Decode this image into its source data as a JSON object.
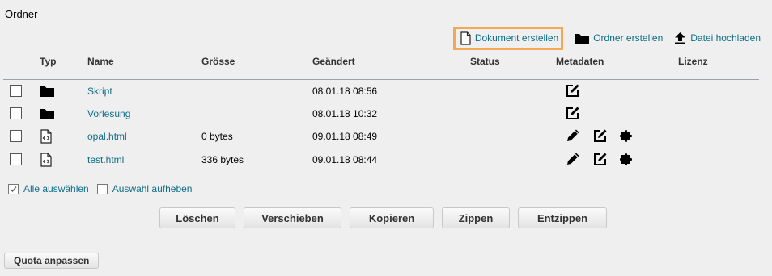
{
  "page": {
    "title": "Ordner"
  },
  "actions": {
    "create_document": "Dokument erstellen",
    "create_folder": "Ordner erstellen",
    "upload_file": "Datei hochladen"
  },
  "table": {
    "headers": {
      "type": "Typ",
      "name": "Name",
      "size": "Grösse",
      "modified": "Geändert",
      "status": "Status",
      "metadata": "Metadaten",
      "license": "Lizenz"
    },
    "rows": [
      {
        "type": "folder",
        "name": "Skript",
        "size": "",
        "modified": "08.01.18 08:56",
        "icons": [
          "edit-icon"
        ]
      },
      {
        "type": "folder",
        "name": "Vorlesung",
        "size": "",
        "modified": "08.01.18 10:32",
        "icons": [
          "edit-icon"
        ]
      },
      {
        "type": "html-file",
        "name": "opal.html",
        "size": "0 bytes",
        "modified": "09.01.18 08:49",
        "icons": [
          "pencil-icon",
          "edit-icon",
          "puzzle-icon"
        ]
      },
      {
        "type": "html-file",
        "name": "test.html",
        "size": "336 bytes",
        "modified": "09.01.18 08:44",
        "icons": [
          "pencil-icon",
          "edit-icon",
          "puzzle-icon"
        ]
      }
    ]
  },
  "selection": {
    "select_all": "Alle auswählen",
    "deselect": "Auswahl aufheben"
  },
  "buttons": {
    "delete": "Löschen",
    "move": "Verschieben",
    "copy": "Kopieren",
    "zip": "Zippen",
    "unzip": "Entzippen",
    "quota": "Quota anpassen"
  },
  "colors": {
    "link": "#0e6e87",
    "highlight": "#f4a856",
    "background": "#efefef"
  }
}
